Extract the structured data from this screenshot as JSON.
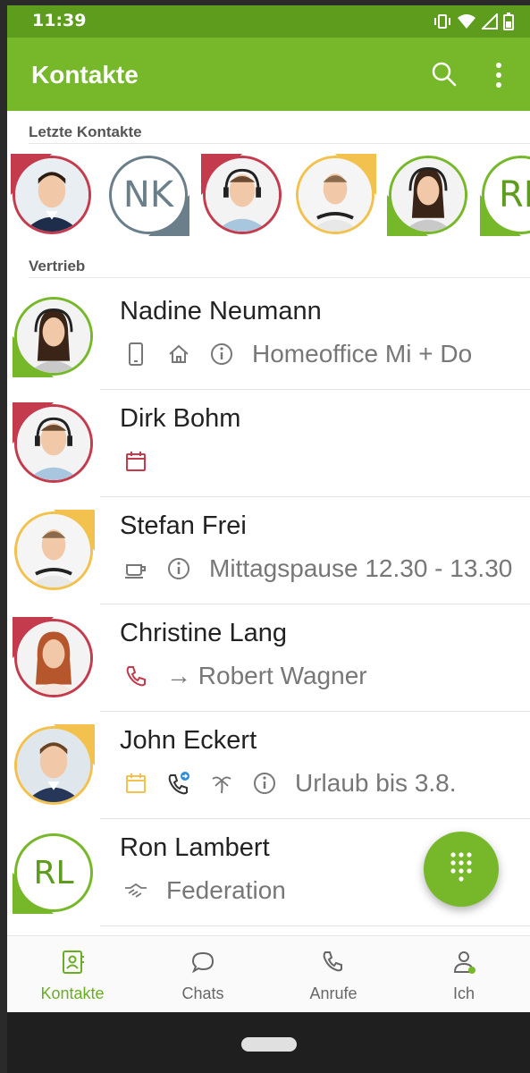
{
  "status_bar": {
    "time": "11:39"
  },
  "app_bar": {
    "title": "Kontakte"
  },
  "recent": {
    "header": "Letzte Kontakte",
    "items": [
      {
        "type": "photo",
        "status_color": "#c33b4c",
        "corner": "red"
      },
      {
        "type": "initials",
        "initials": "NK",
        "status_color": "#6a7f8a",
        "corner": "gray"
      },
      {
        "type": "photo",
        "status_color": "#c33b4c",
        "corner": "red"
      },
      {
        "type": "photo",
        "status_color": "#f2c14e",
        "corner": "yellow"
      },
      {
        "type": "photo",
        "status_color": "#76b82a",
        "corner": "green"
      },
      {
        "type": "initials",
        "initials": "RL",
        "status_color": "#76b82a",
        "corner": "green"
      }
    ]
  },
  "group": {
    "header": "Vertrieb"
  },
  "contacts": [
    {
      "name": "Nadine Neumann",
      "status_color": "#76b82a",
      "icons": [
        "mobile-icon",
        "home-icon",
        "info-icon"
      ],
      "note": "Homeoffice Mi + Do"
    },
    {
      "name": "Dirk Bohm",
      "status_color": "#c33b4c",
      "icons": [
        "calendar-icon"
      ],
      "note": ""
    },
    {
      "name": "Stefan Frei",
      "status_color": "#f2c14e",
      "icons": [
        "coffee-icon",
        "info-icon"
      ],
      "note": "Mittagspause 12.30 - 13.30"
    },
    {
      "name": "Christine Lang",
      "status_color": "#c33b4c",
      "icons": [
        "phone-icon"
      ],
      "note": "→ Robert Wagner"
    },
    {
      "name": "John Eckert",
      "status_color": "#f2c14e",
      "icons": [
        "calendar-icon",
        "phone-forward-icon",
        "palm-icon",
        "info-icon"
      ],
      "note": "Urlaub bis 3.8."
    },
    {
      "name": "Ron Lambert",
      "initials": "RL",
      "status_color": "#76b82a",
      "icons": [
        "handshake-icon"
      ],
      "note": "Federation"
    }
  ],
  "bottom_nav": {
    "contacts": "Kontakte",
    "chats": "Chats",
    "calls": "Anrufe",
    "me": "Ich"
  },
  "colors": {
    "primary": "#76b82a",
    "primary_dark": "#5d9c1c",
    "busy": "#c33b4c",
    "away": "#f2c14e",
    "offline": "#6a7f8a"
  }
}
